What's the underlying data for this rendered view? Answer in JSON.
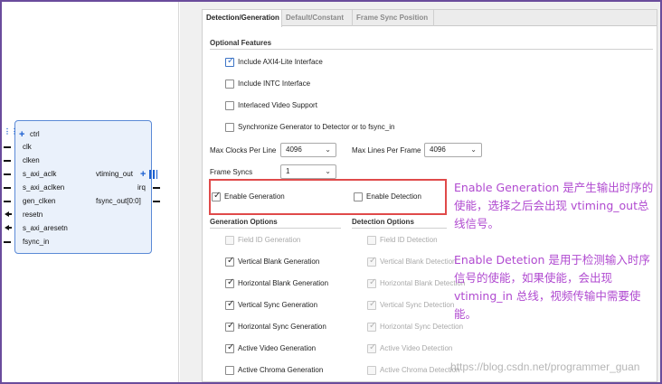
{
  "block": {
    "left_ports": [
      "ctrl",
      "clk",
      "clken",
      "s_axi_aclk",
      "s_axi_aclken",
      "gen_clken",
      "resetn",
      "s_axi_aresetn",
      "fsync_in"
    ],
    "right_ports": [
      "vtiming_out",
      "irq",
      "fsync_out[0:0]"
    ]
  },
  "tabs": [
    "Detection/Generation",
    "Default/Constant",
    "Frame Sync Position"
  ],
  "optional_features": {
    "title": "Optional Features",
    "items": [
      {
        "label": "Include AXI4-Lite Interface",
        "checked": true
      },
      {
        "label": "Include INTC Interface",
        "checked": false
      },
      {
        "label": "Interlaced Video Support",
        "checked": false
      },
      {
        "label": "Synchronize Generator to Detector or to fsync_in",
        "checked": false
      }
    ]
  },
  "fields": {
    "max_clocks_label": "Max Clocks Per Line",
    "max_clocks_value": "4096",
    "max_lines_label": "Max Lines Per Frame",
    "max_lines_value": "4096",
    "frame_syncs_label": "Frame Syncs",
    "frame_syncs_value": "1"
  },
  "enable": {
    "generation": {
      "label": "Enable Generation",
      "checked": true
    },
    "detection": {
      "label": "Enable Detection",
      "checked": false
    }
  },
  "generation_options": {
    "title": "Generation Options",
    "items": [
      {
        "label": "Field ID Generation",
        "checked": false,
        "disabled": true
      },
      {
        "label": "Vertical Blank Generation",
        "checked": true,
        "disabled": false
      },
      {
        "label": "Horizontal Blank Generation",
        "checked": true,
        "disabled": false
      },
      {
        "label": "Vertical Sync Generation",
        "checked": true,
        "disabled": false
      },
      {
        "label": "Horizontal Sync Generation",
        "checked": true,
        "disabled": false
      },
      {
        "label": "Active Video Generation",
        "checked": true,
        "disabled": false
      },
      {
        "label": "Active Chroma Generation",
        "checked": false,
        "disabled": false
      }
    ]
  },
  "detection_options": {
    "title": "Detection Options",
    "items": [
      {
        "label": "Field ID Detection",
        "checked": false
      },
      {
        "label": "Vertical Blank Detection",
        "checked": true
      },
      {
        "label": "Horizontal Blank Detection",
        "checked": true
      },
      {
        "label": "Vertical Sync Detection",
        "checked": true
      },
      {
        "label": "Horizontal Sync Detection",
        "checked": true
      },
      {
        "label": "Active Video Detection",
        "checked": true
      },
      {
        "label": "Active Chroma Detection",
        "checked": false
      }
    ]
  },
  "annotations": {
    "gen_line1": "Enable Generation 是产生输出时序的",
    "gen_line2": "使能，选择之后会出现 vtiming_out总",
    "gen_line3": "线信号。",
    "det_line1": "Enable Detetion 是用于检测输入时序",
    "det_line2": "信号的使能，如果使能，会出现",
    "det_line3": "vtiming_in 总线，视频传输中需要使",
    "det_line4": "能。"
  },
  "watermark": "https://blog.csdn.net/programmer_guan",
  "colors": {
    "frame_border": "#6a4c9c",
    "highlight": "#e04a4a",
    "annotation": "#b04ad0",
    "annotation_bold": "#3b2bd6"
  }
}
